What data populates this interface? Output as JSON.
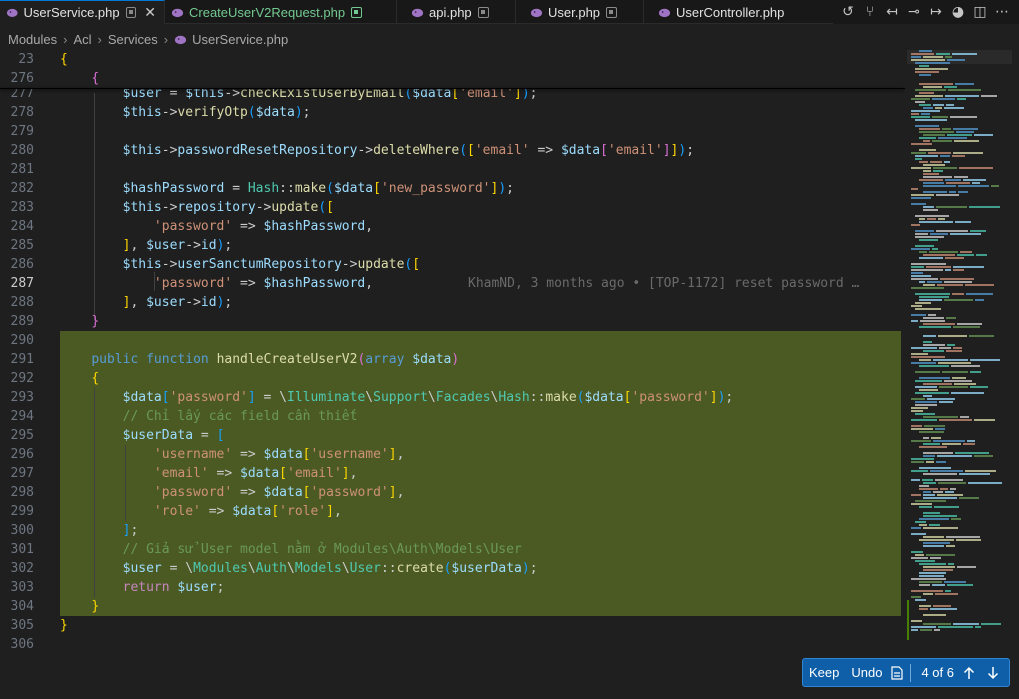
{
  "tabs": [
    {
      "label": "UserService.php",
      "active": true,
      "color": "#e2e2e2"
    },
    {
      "label": "CreateUserV2Request.php",
      "active": false,
      "color": "#73c991"
    },
    {
      "label": "api.php",
      "active": false,
      "color": "#9d9d9d"
    },
    {
      "label": "User.php",
      "active": false,
      "color": "#9d9d9d"
    },
    {
      "label": "UserController.php",
      "active": false,
      "color": "#9d9d9d"
    }
  ],
  "toolbar_icons": [
    "history-icon",
    "source-control-icon",
    "go-back-icon",
    "commit-icon",
    "go-forward-icon",
    "copilot-icon",
    "split-editor-icon",
    "more-actions-icon"
  ],
  "breadcrumb": [
    "Modules",
    "Acl",
    "Services",
    "UserService.php"
  ],
  "editor": {
    "line_numbers": [
      "23",
      "276",
      "277",
      "278",
      "279",
      "280",
      "281",
      "282",
      "283",
      "284",
      "285",
      "286",
      "287",
      "288",
      "289",
      "290",
      "291",
      "292",
      "293",
      "294",
      "295",
      "296",
      "297",
      "298",
      "299",
      "300",
      "301",
      "302",
      "303",
      "304",
      "305",
      "306"
    ],
    "blame_text": "KhamND, 3 months ago • [TOP-1172] reset password …",
    "current_line": "287"
  },
  "keep_undo": {
    "keep_label": "Keep",
    "undo_label": "Undo",
    "position": "4 of 6"
  },
  "colors": {
    "accent": "#0078d4",
    "inserted_bg": "#4b5a23",
    "widget_bg": "#0e5ea8"
  }
}
